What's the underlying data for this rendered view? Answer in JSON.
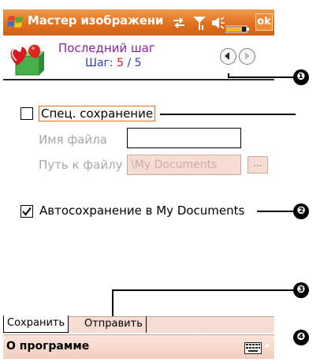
{
  "titlebar": {
    "title": "Мастер изображени",
    "ok_label": "ok",
    "icons": [
      "windows-start-icon",
      "connectivity-icon",
      "signal-icon",
      "volume-icon",
      "battery-icon"
    ]
  },
  "wizard": {
    "step_title": "Последний шаг",
    "step_label": "Шаг:",
    "step_current": "5",
    "step_separator": "/",
    "step_total": "5",
    "nav": [
      "back-icon",
      "forward-icon"
    ]
  },
  "form": {
    "special_save": {
      "label": "Спец. сохранение",
      "checked": false
    },
    "filename": {
      "label": "Имя файла",
      "value": ""
    },
    "filepath": {
      "label": "Путь к файлу",
      "value": "\\My Documents",
      "browse_label": "..."
    },
    "autosave": {
      "label": "Автосохранение в My Documents",
      "checked": true
    }
  },
  "tabs": [
    {
      "label": "Сохранить",
      "active": true
    },
    {
      "label": "Отправить",
      "active": false
    }
  ],
  "menubar": {
    "about_label": "О программе",
    "keyboard_icon": "keyboard-icon"
  },
  "callouts": [
    "❶",
    "❷",
    "❸",
    "❹"
  ],
  "colors": {
    "titlebar": "#e0701f",
    "step_title": "#8b1fa8",
    "step_current": "#d01e1e",
    "step_count": "#2a3fa8",
    "menubar": "#f6dcd3"
  }
}
